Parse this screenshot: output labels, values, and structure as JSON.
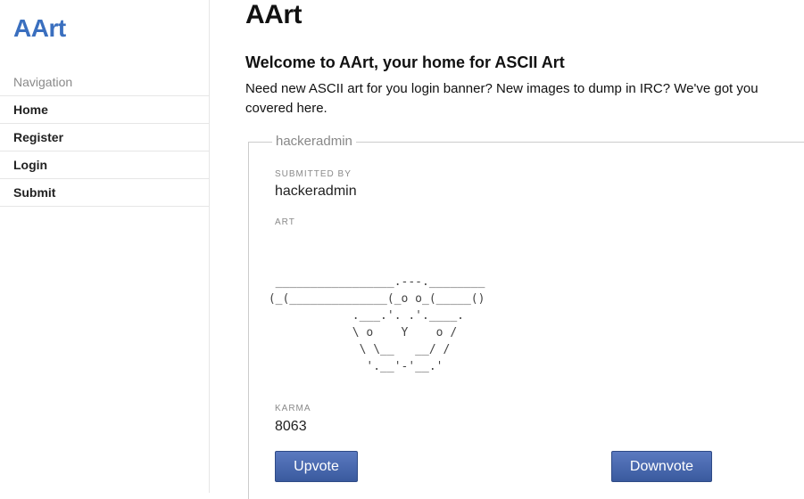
{
  "sidebar": {
    "brand": "AArt",
    "nav_heading": "Navigation",
    "items": [
      {
        "label": "Home"
      },
      {
        "label": "Register"
      },
      {
        "label": "Login"
      },
      {
        "label": "Submit"
      }
    ]
  },
  "main": {
    "title": "AArt",
    "welcome_heading": "Welcome to AArt, your home for ASCII Art",
    "intro": "Need new ASCII art for you login banner? New images to dump in IRC? We've got you covered here."
  },
  "post": {
    "legend": "hackeradmin",
    "submitted_by_label": "SUBMITTED BY",
    "submitted_by": "hackeradmin",
    "art_label": "ART",
    "art": "\n  _________________.---.________\n (_(______________(_o o_(_____()\n             .___.'. .'.____.\n             \\ o    Y    o /\n              \\ \\__   __/ /\n               '.__'-'__.'",
    "karma_label": "KARMA",
    "karma": "8063",
    "upvote_label": "Upvote",
    "downvote_label": "Downvote"
  },
  "colors": {
    "brand": "#3a6fbf",
    "button": "#3a5a9e"
  }
}
